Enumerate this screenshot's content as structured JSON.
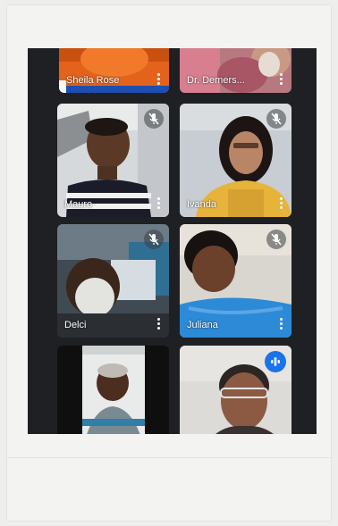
{
  "meeting": {
    "participants": [
      {
        "name": "Sheila Rose",
        "muted": false
      },
      {
        "name": "Dr. Demers...",
        "muted": false
      },
      {
        "name": "Mauro",
        "muted": true
      },
      {
        "name": "Ivanda",
        "muted": true
      },
      {
        "name": "Delci",
        "muted": true
      },
      {
        "name": "Juliana",
        "muted": true
      },
      {
        "name": "",
        "muted": false
      },
      {
        "name": "",
        "muted": false,
        "speaking": true
      }
    ],
    "icons": {
      "more": "more-vert-icon",
      "muted": "mic-off-icon",
      "speaking": "audio-level-icon"
    },
    "colors": {
      "speaking_accent": "#1a73e8",
      "screen_bg": "#1f2023"
    }
  }
}
